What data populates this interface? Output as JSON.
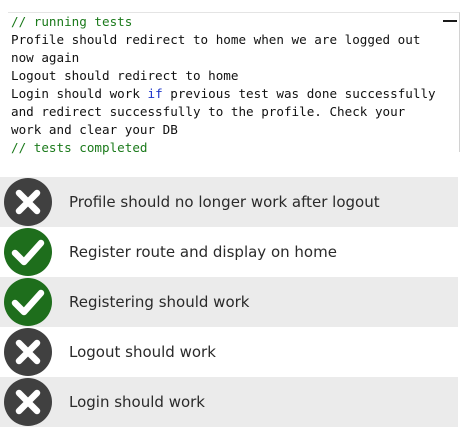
{
  "console": {
    "lines": [
      {
        "segments": [
          {
            "text": "// running tests",
            "style": "comment"
          }
        ]
      },
      {
        "segments": [
          {
            "text": "Profile should redirect to home when we are logged out now again",
            "style": "plain"
          }
        ]
      },
      {
        "segments": [
          {
            "text": "Logout should redirect to home",
            "style": "plain"
          }
        ]
      },
      {
        "segments": [
          {
            "text": "Login should work ",
            "style": "plain"
          },
          {
            "text": "if",
            "style": "kw"
          },
          {
            "text": " previous test was done successfully and redirect successfully to the profile. Check your work and clear your DB",
            "style": "plain"
          }
        ]
      },
      {
        "segments": [
          {
            "text": "// tests completed",
            "style": "comment"
          }
        ]
      }
    ],
    "minimize_icon": "minimize-icon"
  },
  "results": [
    {
      "label": "Profile should no longer work after logout",
      "status": "fail"
    },
    {
      "label": "Register route and display on home",
      "status": "pass"
    },
    {
      "label": "Registering should work",
      "status": "pass"
    },
    {
      "label": "Logout should work",
      "status": "fail"
    },
    {
      "label": "Login should work",
      "status": "fail"
    }
  ],
  "colors": {
    "pass": "#1e6e1c",
    "fail": "#404040",
    "comment": "#1b7a1b",
    "keyword": "#1d35c8"
  },
  "icons": {
    "pass": "checkmark-icon",
    "fail": "x-icon"
  }
}
